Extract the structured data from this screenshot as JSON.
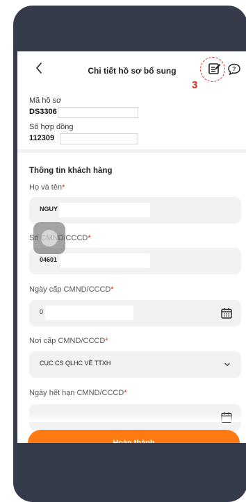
{
  "header": {
    "title": "Chi tiết hồ sơ bổ sung",
    "step_number": "3"
  },
  "icons": {
    "back": "chevron-left-icon",
    "documents": "document-edit-icon",
    "help": "question-bubble-icon",
    "calendar": "calendar-icon",
    "dropdown": "chevron-down-icon"
  },
  "record": {
    "code_label": "Mã hồ sơ",
    "code_value": "DS3306",
    "contract_label": "Số hợp đồng",
    "contract_value": "112309"
  },
  "section": {
    "title": "Thông tin khách hàng"
  },
  "fields": {
    "full_name": {
      "label": "Họ và tên",
      "required": "*",
      "value": "NGUY"
    },
    "id_number": {
      "label": "Số CMND/CCCD",
      "required": "*",
      "value": "04601"
    },
    "issue_date": {
      "label": "Ngày cấp CMND/CCCD",
      "required": "*",
      "value": "0"
    },
    "issue_place": {
      "label": "Nơi cấp CMND/CCCD",
      "required": "*",
      "value": "CỤC CS QLHC VỀ TTXH"
    },
    "expiry_date": {
      "label": "Ngày hết hạn CMND/CCCD",
      "required": "*",
      "value": ""
    }
  },
  "footer": {
    "submit_label": "Hoàn thành"
  },
  "colors": {
    "accent": "#ff7a10",
    "required": "#e1261c",
    "phone_frame": "#363b4b",
    "field_bg": "#f2f2f2"
  }
}
